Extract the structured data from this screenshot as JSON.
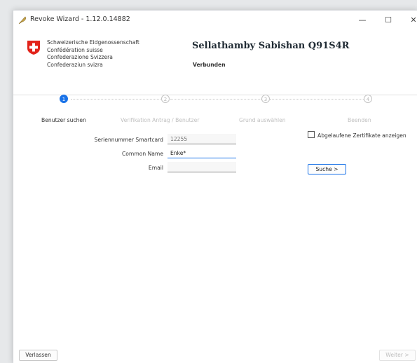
{
  "window": {
    "title": "Revoke Wizard - 1.12.0.14882",
    "controls": {
      "minimize": "—",
      "maximize": "☐",
      "close": "✕"
    }
  },
  "header": {
    "names": [
      "Schweizerische Eidgenossenschaft",
      "Confédération suisse",
      "Confederazione Svizzera",
      "Confederaziun svizra"
    ],
    "user": "Sellathamby Sabishan Q91S4R",
    "status": "Verbunden",
    "flag_color": "#e2231a"
  },
  "stepper": {
    "steps": [
      {
        "number": "1",
        "label": "Benutzer suchen",
        "active": true
      },
      {
        "number": "2",
        "label": "Verifikation Antrag / Benutzer",
        "active": false
      },
      {
        "number": "3",
        "label": "Grund auswählen",
        "active": false
      },
      {
        "number": "4",
        "label": "Beenden",
        "active": false
      }
    ],
    "accent_color": "#1a73e8"
  },
  "options": {
    "show_expired_label": "Abgelaufene Zertifikate anzeigen",
    "show_expired_checked": false
  },
  "form": {
    "serial_label": "Seriennummer Smartcard",
    "serial_placeholder": "12255",
    "cn_label": "Common Name",
    "cn_value": "Enke*",
    "email_label": "Email",
    "email_value": "",
    "search_label": "Suche >"
  },
  "footer": {
    "exit_label": "Verlassen",
    "next_label": "Weiter >"
  }
}
